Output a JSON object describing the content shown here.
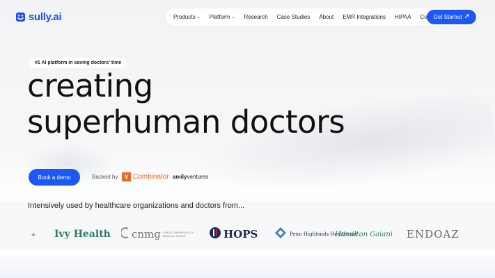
{
  "brand": {
    "name": "sully.ai",
    "color": "#1f4ef0"
  },
  "nav": {
    "items": [
      {
        "label": "Products",
        "dropdown": true
      },
      {
        "label": "Platform",
        "dropdown": true
      },
      {
        "label": "Research",
        "dropdown": false
      },
      {
        "label": "Case Studies",
        "dropdown": false
      },
      {
        "label": "About",
        "dropdown": false
      },
      {
        "label": "EMR Integrations",
        "dropdown": false
      },
      {
        "label": "HIPAA",
        "dropdown": false
      },
      {
        "label": "Contact",
        "dropdown": false
      }
    ],
    "cta_label": "Get Started",
    "cta_icon": "arrow-up-right-icon"
  },
  "hero": {
    "badge": "#1 AI platform in saving doctors' time",
    "headline_line1": "creating",
    "headline_line2": "superhuman doctors",
    "book_demo_label": "Book a demo",
    "backed_label": "Backed by",
    "yc_letter": "Y",
    "yc_name": "Combinator",
    "amily_bold": "amily",
    "amily_rest": "ventures"
  },
  "clients": {
    "intro": "Intensively used by healthcare organizations and doctors from...",
    "ivy": "Ivy Health",
    "cnmg": "cnmg",
    "cnmg_sub": "CHRIST NEPHROLOGY MEDICAL GROUP",
    "hops": "HOPS",
    "penn": "Penn Highlands Healthcare",
    "hamilton": "Hamilton Gaiani",
    "endo": "ENDOAZ"
  },
  "colors": {
    "accent": "#1b58f5",
    "yc": "#f26625"
  }
}
